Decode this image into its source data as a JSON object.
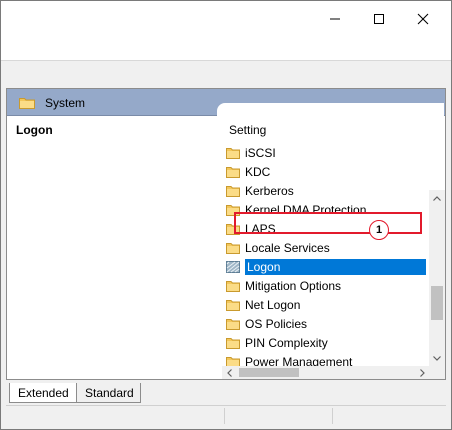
{
  "window": {
    "controls": [
      "minimize",
      "maximize",
      "close"
    ]
  },
  "header": {
    "title": "System",
    "icon": "folder-icon"
  },
  "left_pane": {
    "heading": "Logon"
  },
  "right_pane": {
    "column_header": "Setting",
    "items": [
      {
        "label": "iSCSI",
        "icon": "folder-icon",
        "selected": false
      },
      {
        "label": "KDC",
        "icon": "folder-icon",
        "selected": false
      },
      {
        "label": "Kerberos",
        "icon": "folder-icon",
        "selected": false
      },
      {
        "label": "Kernel DMA Protection",
        "icon": "folder-icon",
        "selected": false
      },
      {
        "label": "LAPS",
        "icon": "folder-icon",
        "selected": false
      },
      {
        "label": "Locale Services",
        "icon": "folder-icon",
        "selected": false
      },
      {
        "label": "Logon",
        "icon": "open-folder-icon",
        "selected": true
      },
      {
        "label": "Mitigation Options",
        "icon": "folder-icon",
        "selected": false
      },
      {
        "label": "Net Logon",
        "icon": "folder-icon",
        "selected": false
      },
      {
        "label": "OS Policies",
        "icon": "folder-icon",
        "selected": false
      },
      {
        "label": "PIN Complexity",
        "icon": "folder-icon",
        "selected": false
      },
      {
        "label": "Power Management",
        "icon": "folder-icon",
        "selected": false
      }
    ]
  },
  "annotation": {
    "marker": "1",
    "color": "#e21a2c"
  },
  "tabs": [
    {
      "label": "Extended",
      "active": true
    },
    {
      "label": "Standard",
      "active": false
    }
  ],
  "colors": {
    "header_bg": "#95a9c9",
    "selection": "#0078d7",
    "folder": "#f3c75b"
  }
}
